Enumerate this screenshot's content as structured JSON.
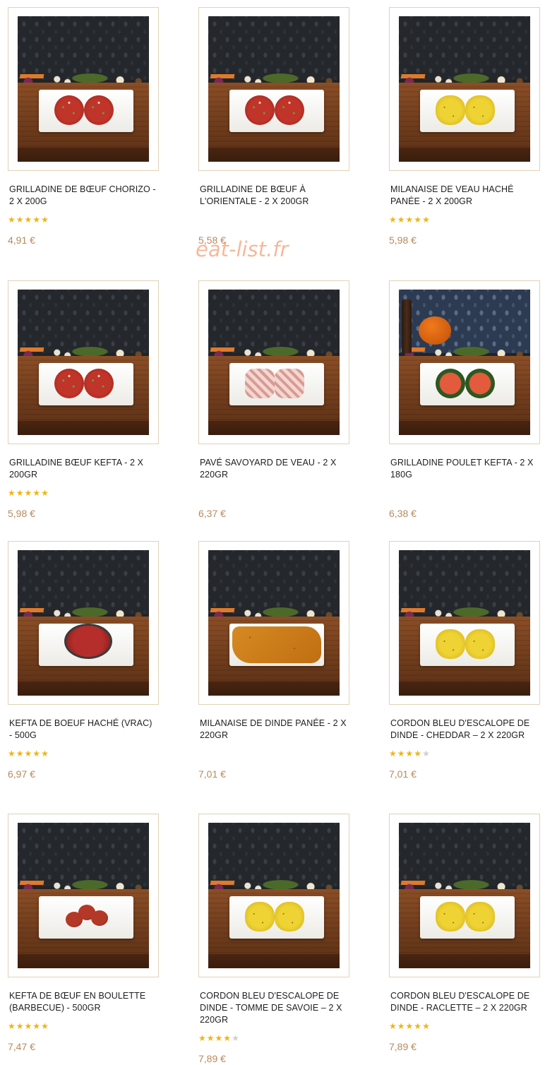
{
  "watermark": "eat-list.fr",
  "colors": {
    "price": "#b88a5c",
    "star_on": "#f2b410",
    "star_off": "#cfcfcf",
    "frame_border": "#e2d2b8",
    "watermark": "#ec8048"
  },
  "icons": {
    "star": "★"
  },
  "products": [
    {
      "name": "GRILLADINE DE BŒUF CHORIZO - 2 X 200G",
      "rating": 5,
      "price": "4,91 €",
      "image": "two-beef-chorizo-patties-on-plate"
    },
    {
      "name": "GRILLADINE DE BŒUF À L'ORIENTALE - 2 X 200GR",
      "rating": 0,
      "price": "5,58 €",
      "image": "two-oriental-beef-patties-on-plate"
    },
    {
      "name": "MILANAISE DE VEAU HACHÉ PANÉE - 2 X 200GR",
      "rating": 5,
      "price": "5,98 €",
      "image": "two-breaded-veal-milanese-on-plate"
    },
    {
      "name": "GRILLADINE BŒUF KEFTA - 2 X 200GR",
      "rating": 5,
      "price": "5,98 €",
      "image": "two-beef-kefta-patties-on-plate"
    },
    {
      "name": "PAVÉ SAVOYARD DE VEAU - 2 X 220GR",
      "rating": 0,
      "price": "6,37 €",
      "image": "two-bacon-wrapped-veal-on-plate"
    },
    {
      "name": "GRILLADINE POULET KEFTA - 2 X 180G",
      "rating": 0,
      "price": "6,38 €",
      "image": "two-chicken-kefta-patties-on-plate"
    },
    {
      "name": "KEFTA DE BOEUF HACHÉ (VRAC) - 500G",
      "rating": 5,
      "price": "6,97 €",
      "image": "minced-beef-kefta-in-bowl"
    },
    {
      "name": "MILANAISE DE DINDE PANÉE - 2 X 220GR",
      "rating": 0,
      "price": "7,01 €",
      "image": "breaded-turkey-cutlet-on-plate"
    },
    {
      "name": "CORDON BLEU D'ESCALOPE DE DINDE - CHEDDAR – 2 X 220GR",
      "rating": 4,
      "price": "7,01 €",
      "image": "two-cheddar-cordon-bleu-on-plate"
    },
    {
      "name": "KEFTA DE BŒUF EN BOULETTE (BARBECUE) - 500GR",
      "rating": 5,
      "price": "7,47 €",
      "image": "bbq-beef-kefta-meatballs-on-plate"
    },
    {
      "name": "CORDON BLEU D'ESCALOPE DE DINDE - TOMME DE SAVOIE – 2 X 220GR",
      "rating": 4,
      "price": "7,89 €",
      "image": "two-tomme-cordon-bleu-on-plate"
    },
    {
      "name": "CORDON BLEU D'ESCALOPE DE DINDE - RACLETTE – 2 X 220GR",
      "rating": 5,
      "price": "7,89 €",
      "image": "two-raclette-cordon-bleu-on-plate"
    }
  ]
}
